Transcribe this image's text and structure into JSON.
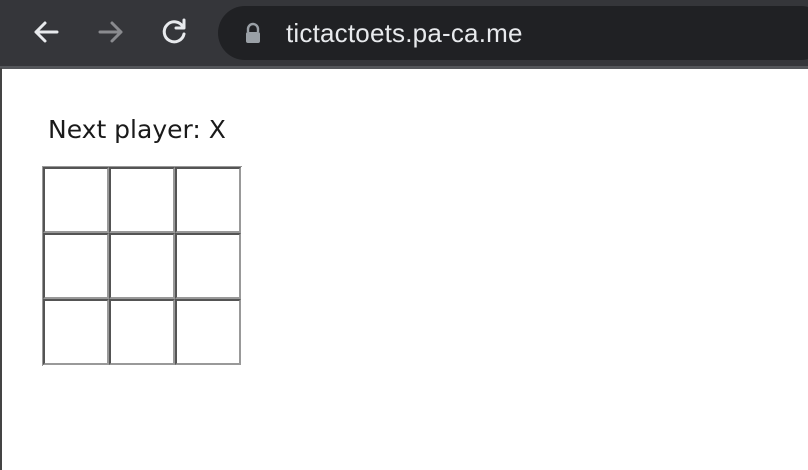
{
  "browser": {
    "url": "tictactoets.pa-ca.me",
    "icons": {
      "back": "arrow-left-icon",
      "forward": "arrow-right-icon",
      "reload": "reload-icon",
      "lock": "lock-icon"
    },
    "colors": {
      "toolbar": "#35363a",
      "omnibox": "#202124",
      "active_icon": "#e8eaed",
      "disabled_icon": "#8a8b8f"
    }
  },
  "game": {
    "status": "Next player: X",
    "squares": [
      "",
      "",
      "",
      "",
      "",
      "",
      "",
      "",
      ""
    ]
  }
}
